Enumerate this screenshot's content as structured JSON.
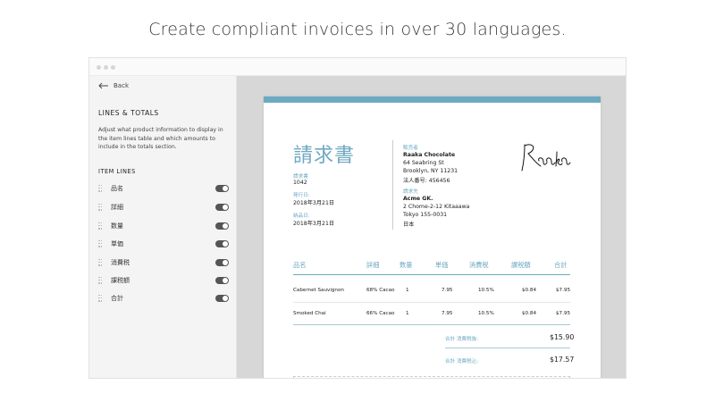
{
  "headline": "Create compliant invoices in over 30 languages.",
  "sidebar": {
    "back_label": "Back",
    "section_title": "LINES & TOTALS",
    "section_desc": "Adjust what product information to display in the item lines table and which amounts to include in the totals section.",
    "items_title": "ITEM LINES",
    "items": [
      {
        "label": "品名",
        "on": true
      },
      {
        "label": "詳細",
        "on": true
      },
      {
        "label": "数量",
        "on": true
      },
      {
        "label": "単価",
        "on": true
      },
      {
        "label": "消費税",
        "on": true
      },
      {
        "label": "課税額",
        "on": true
      },
      {
        "label": "合計",
        "on": true
      }
    ]
  },
  "invoice": {
    "title": "請求書",
    "number_label": "請求書",
    "number": "1042",
    "issue_label": "発行日:",
    "issue_date": "2018年3月21日",
    "due_label": "納品日:",
    "due_date": "2018年3月21日",
    "seller_label": "販売者",
    "seller_lines": [
      "Raaka Chocolate",
      "64 Seabring St",
      "Brooklyn, NY 11231",
      "法人番号: 456456"
    ],
    "buyer_label": "請求先",
    "buyer_lines": [
      "Acme GK.",
      "2 Chome-2-12 Kitaaawa",
      "Tokyo 155-0031",
      "日本"
    ],
    "logo_text": "Raaka",
    "columns": [
      "品名",
      "詳細",
      "数量",
      "単価",
      "消費税",
      "課税額",
      "合計"
    ],
    "rows": [
      [
        "Cabernet Sauvignon",
        "68% Cacao",
        "1",
        "7.95",
        "10.5%",
        "$0.84",
        "$7.95"
      ],
      [
        "Smoked Chai",
        "66% Cacao",
        "1",
        "7.95",
        "10.5%",
        "$0.84",
        "$7.95"
      ]
    ],
    "subtotal_label": "合計 消費税抜:",
    "subtotal": "$15.90",
    "total_label": "合計 消費税込:",
    "total": "$17.57"
  },
  "colors": {
    "accent": "#6ea9c2",
    "canvas_bg": "#d7d7d7",
    "toggle_on": "#555555"
  }
}
